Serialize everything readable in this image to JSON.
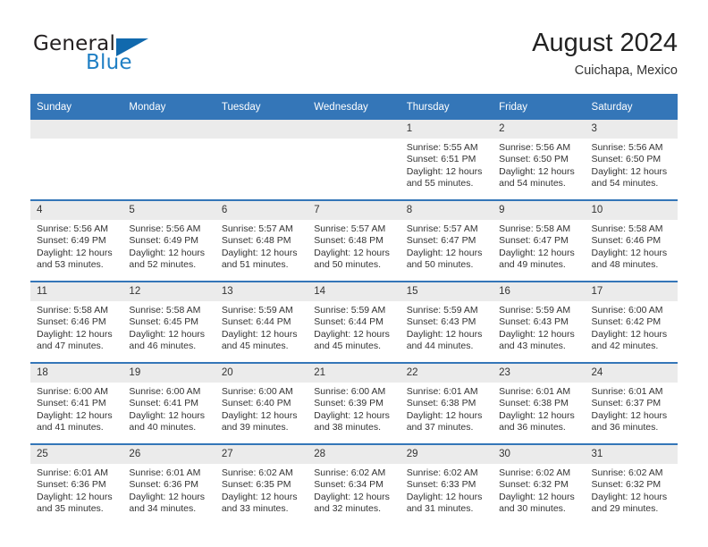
{
  "brand": {
    "name_part1": "General",
    "name_part2": "Blue",
    "logo_icon": "triangle-flag-icon"
  },
  "header": {
    "title": "August 2024",
    "subtitle": "Cuichapa, Mexico"
  },
  "colors": {
    "header_blue": "#3476b8",
    "daynum_grey": "#ebebeb",
    "brand_blue": "#1f7fc4",
    "text": "#333333"
  },
  "calendar": {
    "weekday_headers": [
      "Sunday",
      "Monday",
      "Tuesday",
      "Wednesday",
      "Thursday",
      "Friday",
      "Saturday"
    ],
    "weeks": [
      [
        {
          "day": "",
          "empty": true
        },
        {
          "day": "",
          "empty": true
        },
        {
          "day": "",
          "empty": true
        },
        {
          "day": "",
          "empty": true
        },
        {
          "day": "1",
          "sunrise": "Sunrise: 5:55 AM",
          "sunset": "Sunset: 6:51 PM",
          "daylight": "Daylight: 12 hours and 55 minutes."
        },
        {
          "day": "2",
          "sunrise": "Sunrise: 5:56 AM",
          "sunset": "Sunset: 6:50 PM",
          "daylight": "Daylight: 12 hours and 54 minutes."
        },
        {
          "day": "3",
          "sunrise": "Sunrise: 5:56 AM",
          "sunset": "Sunset: 6:50 PM",
          "daylight": "Daylight: 12 hours and 54 minutes."
        }
      ],
      [
        {
          "day": "4",
          "sunrise": "Sunrise: 5:56 AM",
          "sunset": "Sunset: 6:49 PM",
          "daylight": "Daylight: 12 hours and 53 minutes."
        },
        {
          "day": "5",
          "sunrise": "Sunrise: 5:56 AM",
          "sunset": "Sunset: 6:49 PM",
          "daylight": "Daylight: 12 hours and 52 minutes."
        },
        {
          "day": "6",
          "sunrise": "Sunrise: 5:57 AM",
          "sunset": "Sunset: 6:48 PM",
          "daylight": "Daylight: 12 hours and 51 minutes."
        },
        {
          "day": "7",
          "sunrise": "Sunrise: 5:57 AM",
          "sunset": "Sunset: 6:48 PM",
          "daylight": "Daylight: 12 hours and 50 minutes."
        },
        {
          "day": "8",
          "sunrise": "Sunrise: 5:57 AM",
          "sunset": "Sunset: 6:47 PM",
          "daylight": "Daylight: 12 hours and 50 minutes."
        },
        {
          "day": "9",
          "sunrise": "Sunrise: 5:58 AM",
          "sunset": "Sunset: 6:47 PM",
          "daylight": "Daylight: 12 hours and 49 minutes."
        },
        {
          "day": "10",
          "sunrise": "Sunrise: 5:58 AM",
          "sunset": "Sunset: 6:46 PM",
          "daylight": "Daylight: 12 hours and 48 minutes."
        }
      ],
      [
        {
          "day": "11",
          "sunrise": "Sunrise: 5:58 AM",
          "sunset": "Sunset: 6:46 PM",
          "daylight": "Daylight: 12 hours and 47 minutes."
        },
        {
          "day": "12",
          "sunrise": "Sunrise: 5:58 AM",
          "sunset": "Sunset: 6:45 PM",
          "daylight": "Daylight: 12 hours and 46 minutes."
        },
        {
          "day": "13",
          "sunrise": "Sunrise: 5:59 AM",
          "sunset": "Sunset: 6:44 PM",
          "daylight": "Daylight: 12 hours and 45 minutes."
        },
        {
          "day": "14",
          "sunrise": "Sunrise: 5:59 AM",
          "sunset": "Sunset: 6:44 PM",
          "daylight": "Daylight: 12 hours and 45 minutes."
        },
        {
          "day": "15",
          "sunrise": "Sunrise: 5:59 AM",
          "sunset": "Sunset: 6:43 PM",
          "daylight": "Daylight: 12 hours and 44 minutes."
        },
        {
          "day": "16",
          "sunrise": "Sunrise: 5:59 AM",
          "sunset": "Sunset: 6:43 PM",
          "daylight": "Daylight: 12 hours and 43 minutes."
        },
        {
          "day": "17",
          "sunrise": "Sunrise: 6:00 AM",
          "sunset": "Sunset: 6:42 PM",
          "daylight": "Daylight: 12 hours and 42 minutes."
        }
      ],
      [
        {
          "day": "18",
          "sunrise": "Sunrise: 6:00 AM",
          "sunset": "Sunset: 6:41 PM",
          "daylight": "Daylight: 12 hours and 41 minutes."
        },
        {
          "day": "19",
          "sunrise": "Sunrise: 6:00 AM",
          "sunset": "Sunset: 6:41 PM",
          "daylight": "Daylight: 12 hours and 40 minutes."
        },
        {
          "day": "20",
          "sunrise": "Sunrise: 6:00 AM",
          "sunset": "Sunset: 6:40 PM",
          "daylight": "Daylight: 12 hours and 39 minutes."
        },
        {
          "day": "21",
          "sunrise": "Sunrise: 6:00 AM",
          "sunset": "Sunset: 6:39 PM",
          "daylight": "Daylight: 12 hours and 38 minutes."
        },
        {
          "day": "22",
          "sunrise": "Sunrise: 6:01 AM",
          "sunset": "Sunset: 6:38 PM",
          "daylight": "Daylight: 12 hours and 37 minutes."
        },
        {
          "day": "23",
          "sunrise": "Sunrise: 6:01 AM",
          "sunset": "Sunset: 6:38 PM",
          "daylight": "Daylight: 12 hours and 36 minutes."
        },
        {
          "day": "24",
          "sunrise": "Sunrise: 6:01 AM",
          "sunset": "Sunset: 6:37 PM",
          "daylight": "Daylight: 12 hours and 36 minutes."
        }
      ],
      [
        {
          "day": "25",
          "sunrise": "Sunrise: 6:01 AM",
          "sunset": "Sunset: 6:36 PM",
          "daylight": "Daylight: 12 hours and 35 minutes."
        },
        {
          "day": "26",
          "sunrise": "Sunrise: 6:01 AM",
          "sunset": "Sunset: 6:36 PM",
          "daylight": "Daylight: 12 hours and 34 minutes."
        },
        {
          "day": "27",
          "sunrise": "Sunrise: 6:02 AM",
          "sunset": "Sunset: 6:35 PM",
          "daylight": "Daylight: 12 hours and 33 minutes."
        },
        {
          "day": "28",
          "sunrise": "Sunrise: 6:02 AM",
          "sunset": "Sunset: 6:34 PM",
          "daylight": "Daylight: 12 hours and 32 minutes."
        },
        {
          "day": "29",
          "sunrise": "Sunrise: 6:02 AM",
          "sunset": "Sunset: 6:33 PM",
          "daylight": "Daylight: 12 hours and 31 minutes."
        },
        {
          "day": "30",
          "sunrise": "Sunrise: 6:02 AM",
          "sunset": "Sunset: 6:32 PM",
          "daylight": "Daylight: 12 hours and 30 minutes."
        },
        {
          "day": "31",
          "sunrise": "Sunrise: 6:02 AM",
          "sunset": "Sunset: 6:32 PM",
          "daylight": "Daylight: 12 hours and 29 minutes."
        }
      ]
    ]
  }
}
